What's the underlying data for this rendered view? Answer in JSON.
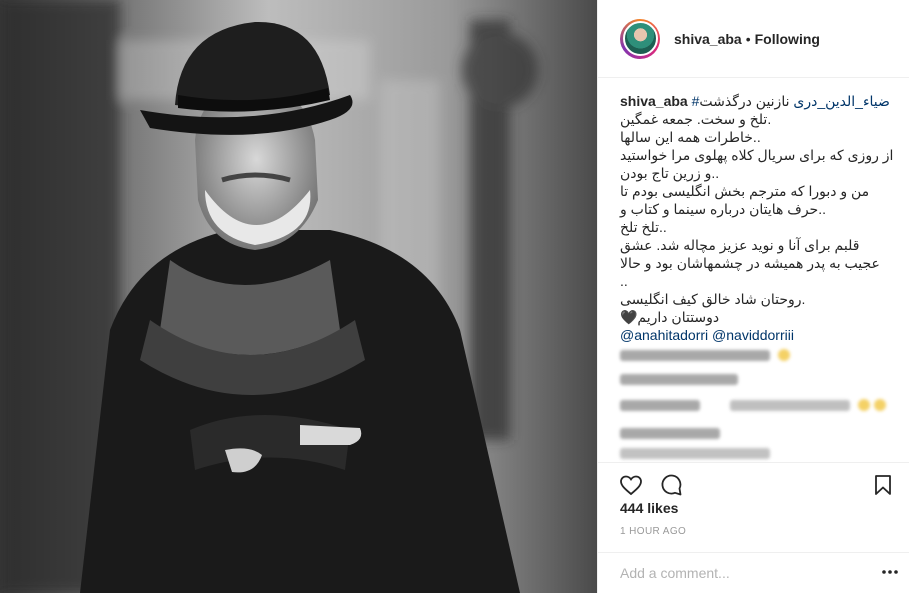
{
  "post": {
    "image_alt": "Black and white portrait of a man in a hat and scarf"
  },
  "header": {
    "username": "shiva_aba",
    "separator": "•",
    "follow_status": "Following"
  },
  "caption": {
    "username": "shiva_aba",
    "hashtag": "#ضیاء_الدین_دری",
    "first_line_rest": " نازنین درگذشت",
    "lines": [
      ".تلخ و سخت. جمعه غمگین",
      "..خاطرات همه این سالها",
      "از روزی که برای سریال کلاه پهلوی مرا خواستید",
      "..و زرین تاج بودن",
      "من و دبورا که مترجم بخش انگلیسی بودم تا",
      "..حرف هایتان درباره سینما و کتاب و",
      "..تلخ تلخ",
      "قلبم برای آنا و نوید عزیز مچاله شد. عشق",
      "عجیب به پدر همیشه در چشمهاشان بود و حالا",
      "..",
      ".روحتان شاد خالق کیف انگلیسی",
      "دوستتان داریم🖤"
    ],
    "mentions": "@anahitadorri @naviddorriii"
  },
  "actions": {
    "like_icon": "heart-icon",
    "comment_icon": "comment-icon",
    "save_icon": "bookmark-icon"
  },
  "likes": "444 likes",
  "timestamp": "1 HOUR AGO",
  "comment": {
    "placeholder": "Add a comment...",
    "more_icon": "more-options-icon"
  },
  "colors": {
    "link": "#003569",
    "muted": "#999999",
    "border": "#efefef",
    "text": "#262626"
  }
}
